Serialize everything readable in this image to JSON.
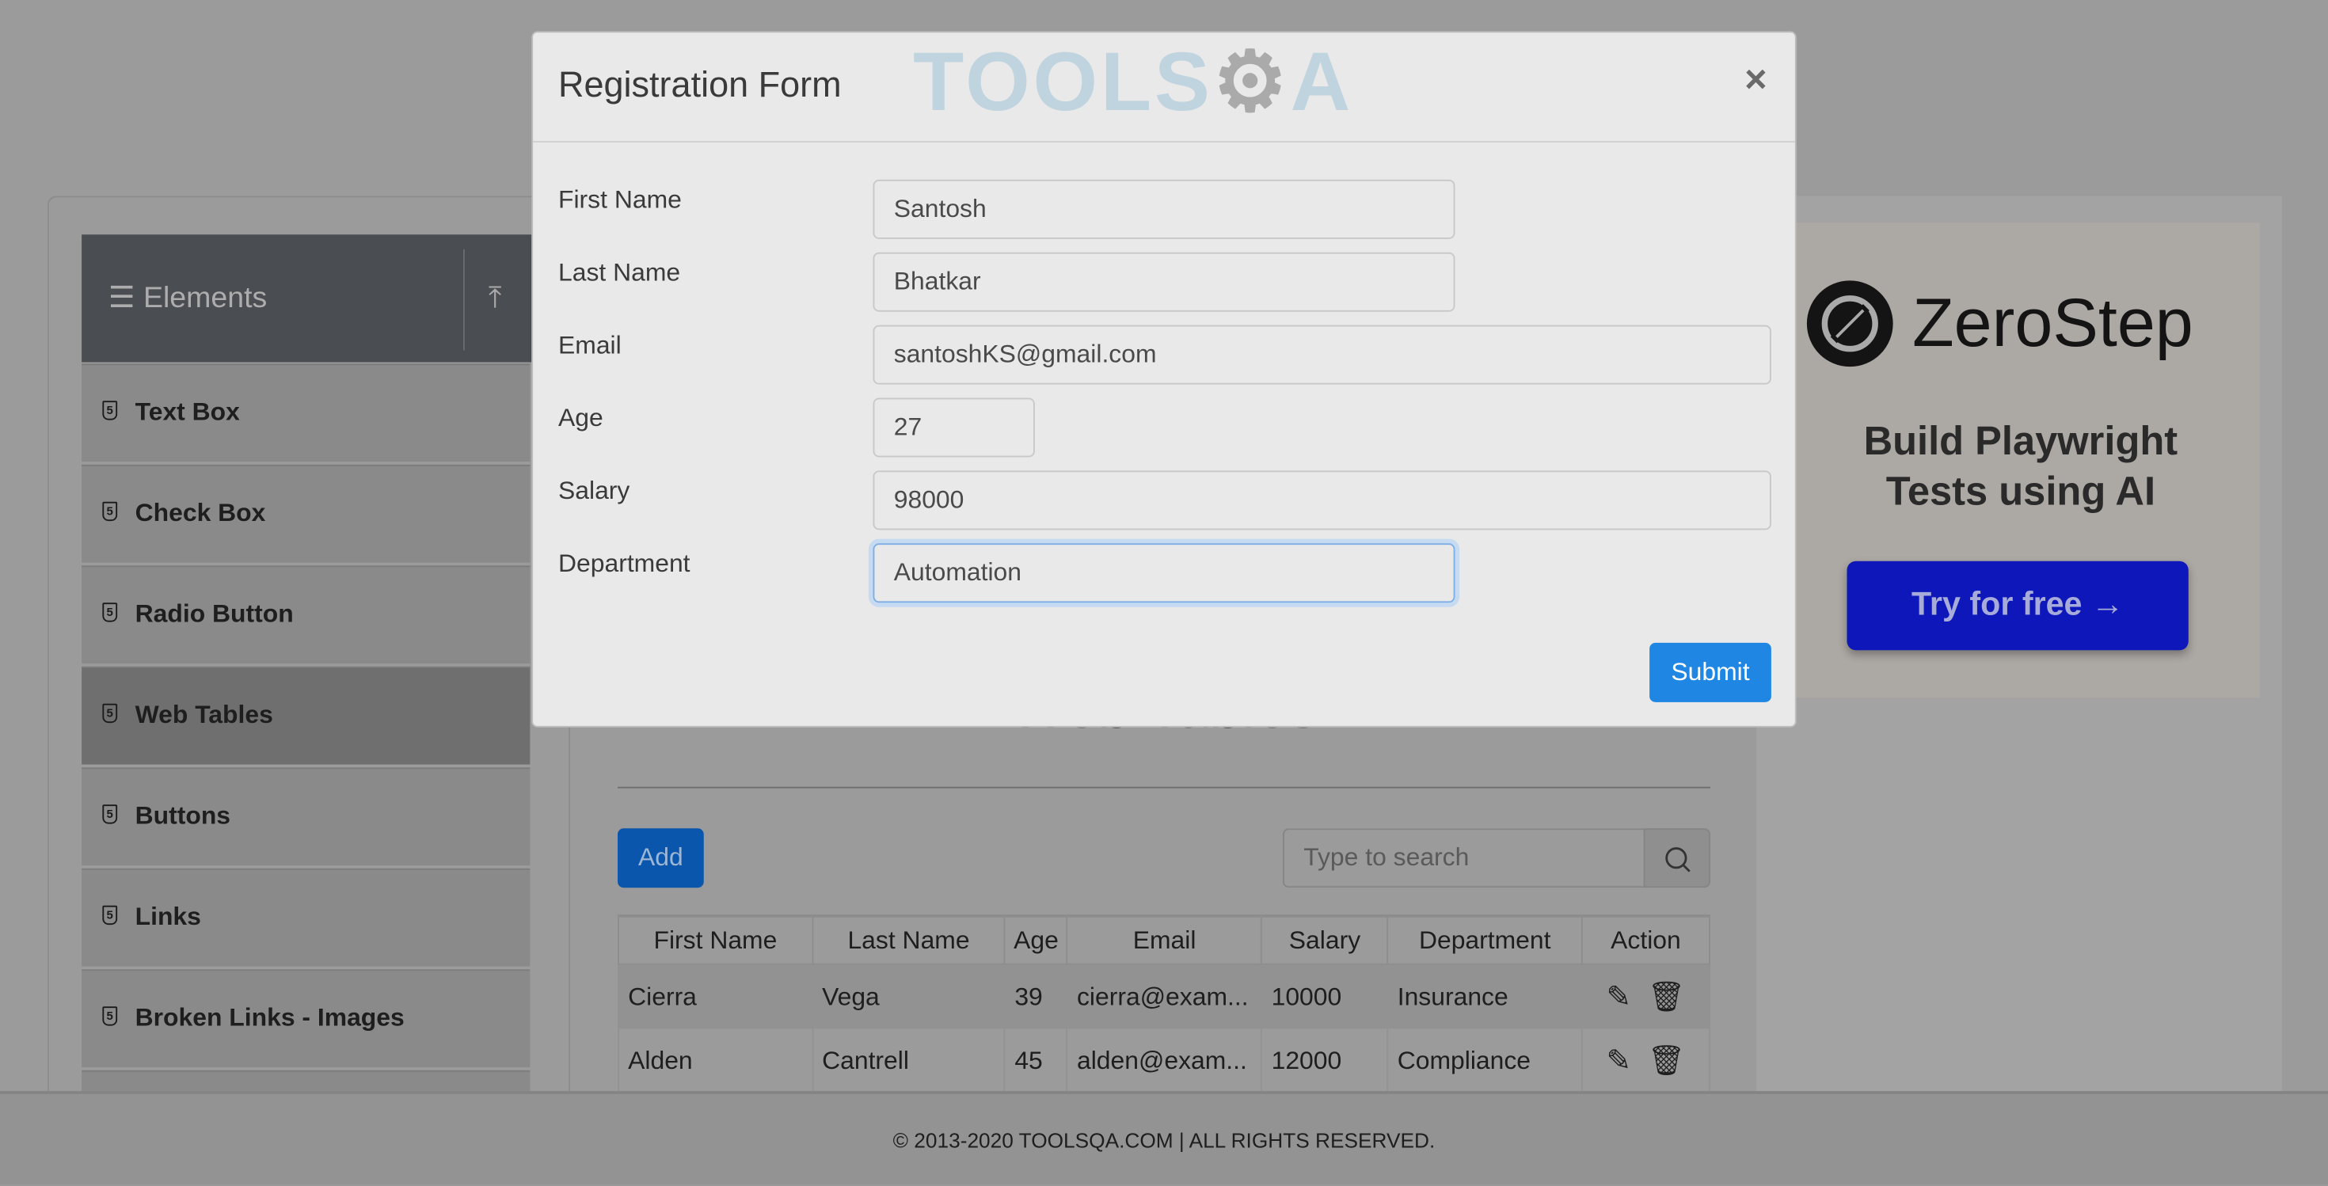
{
  "sidebar": {
    "header": "Elements",
    "items": [
      {
        "label": "Text Box"
      },
      {
        "label": "Check Box"
      },
      {
        "label": "Radio Button"
      },
      {
        "label": "Web Tables",
        "active": true
      },
      {
        "label": "Buttons"
      },
      {
        "label": "Links"
      },
      {
        "label": "Broken Links - Images"
      }
    ]
  },
  "main": {
    "title": "Web Tables",
    "add_label": "Add",
    "search_placeholder": "Type to search",
    "table": {
      "headers": [
        "First Name",
        "Last Name",
        "Age",
        "Email",
        "Salary",
        "Department",
        "Action"
      ],
      "rows": [
        [
          "Cierra",
          "Vega",
          "39",
          "cierra@exam...",
          "10000",
          "Insurance"
        ],
        [
          "Alden",
          "Cantrell",
          "45",
          "alden@exam...",
          "12000",
          "Compliance"
        ]
      ]
    }
  },
  "modal": {
    "title": "Registration Form",
    "logo_text": "TOOLSQA",
    "close": "×",
    "fields": [
      {
        "label": "First Name",
        "value": "Santosh"
      },
      {
        "label": "Last Name",
        "value": "Bhatkar"
      },
      {
        "label": "Email",
        "value": "santoshKS@gmail.com"
      },
      {
        "label": "Age",
        "value": "27"
      },
      {
        "label": "Salary",
        "value": "98000"
      },
      {
        "label": "Department",
        "value": "Automation"
      }
    ],
    "submit_label": "Submit"
  },
  "ad": {
    "brand": "ZeroStep",
    "headline_1": "Build Playwright",
    "headline_2": "Tests using AI",
    "cta": "Try for free →"
  },
  "footer": {
    "text": "© 2013-2020 TOOLSQA.COM | ALL RIGHTS RESERVED."
  },
  "colors": {
    "primary": "#1f86e4",
    "cta": "#0e17b9",
    "sidebar_header": "#4a4d51"
  }
}
